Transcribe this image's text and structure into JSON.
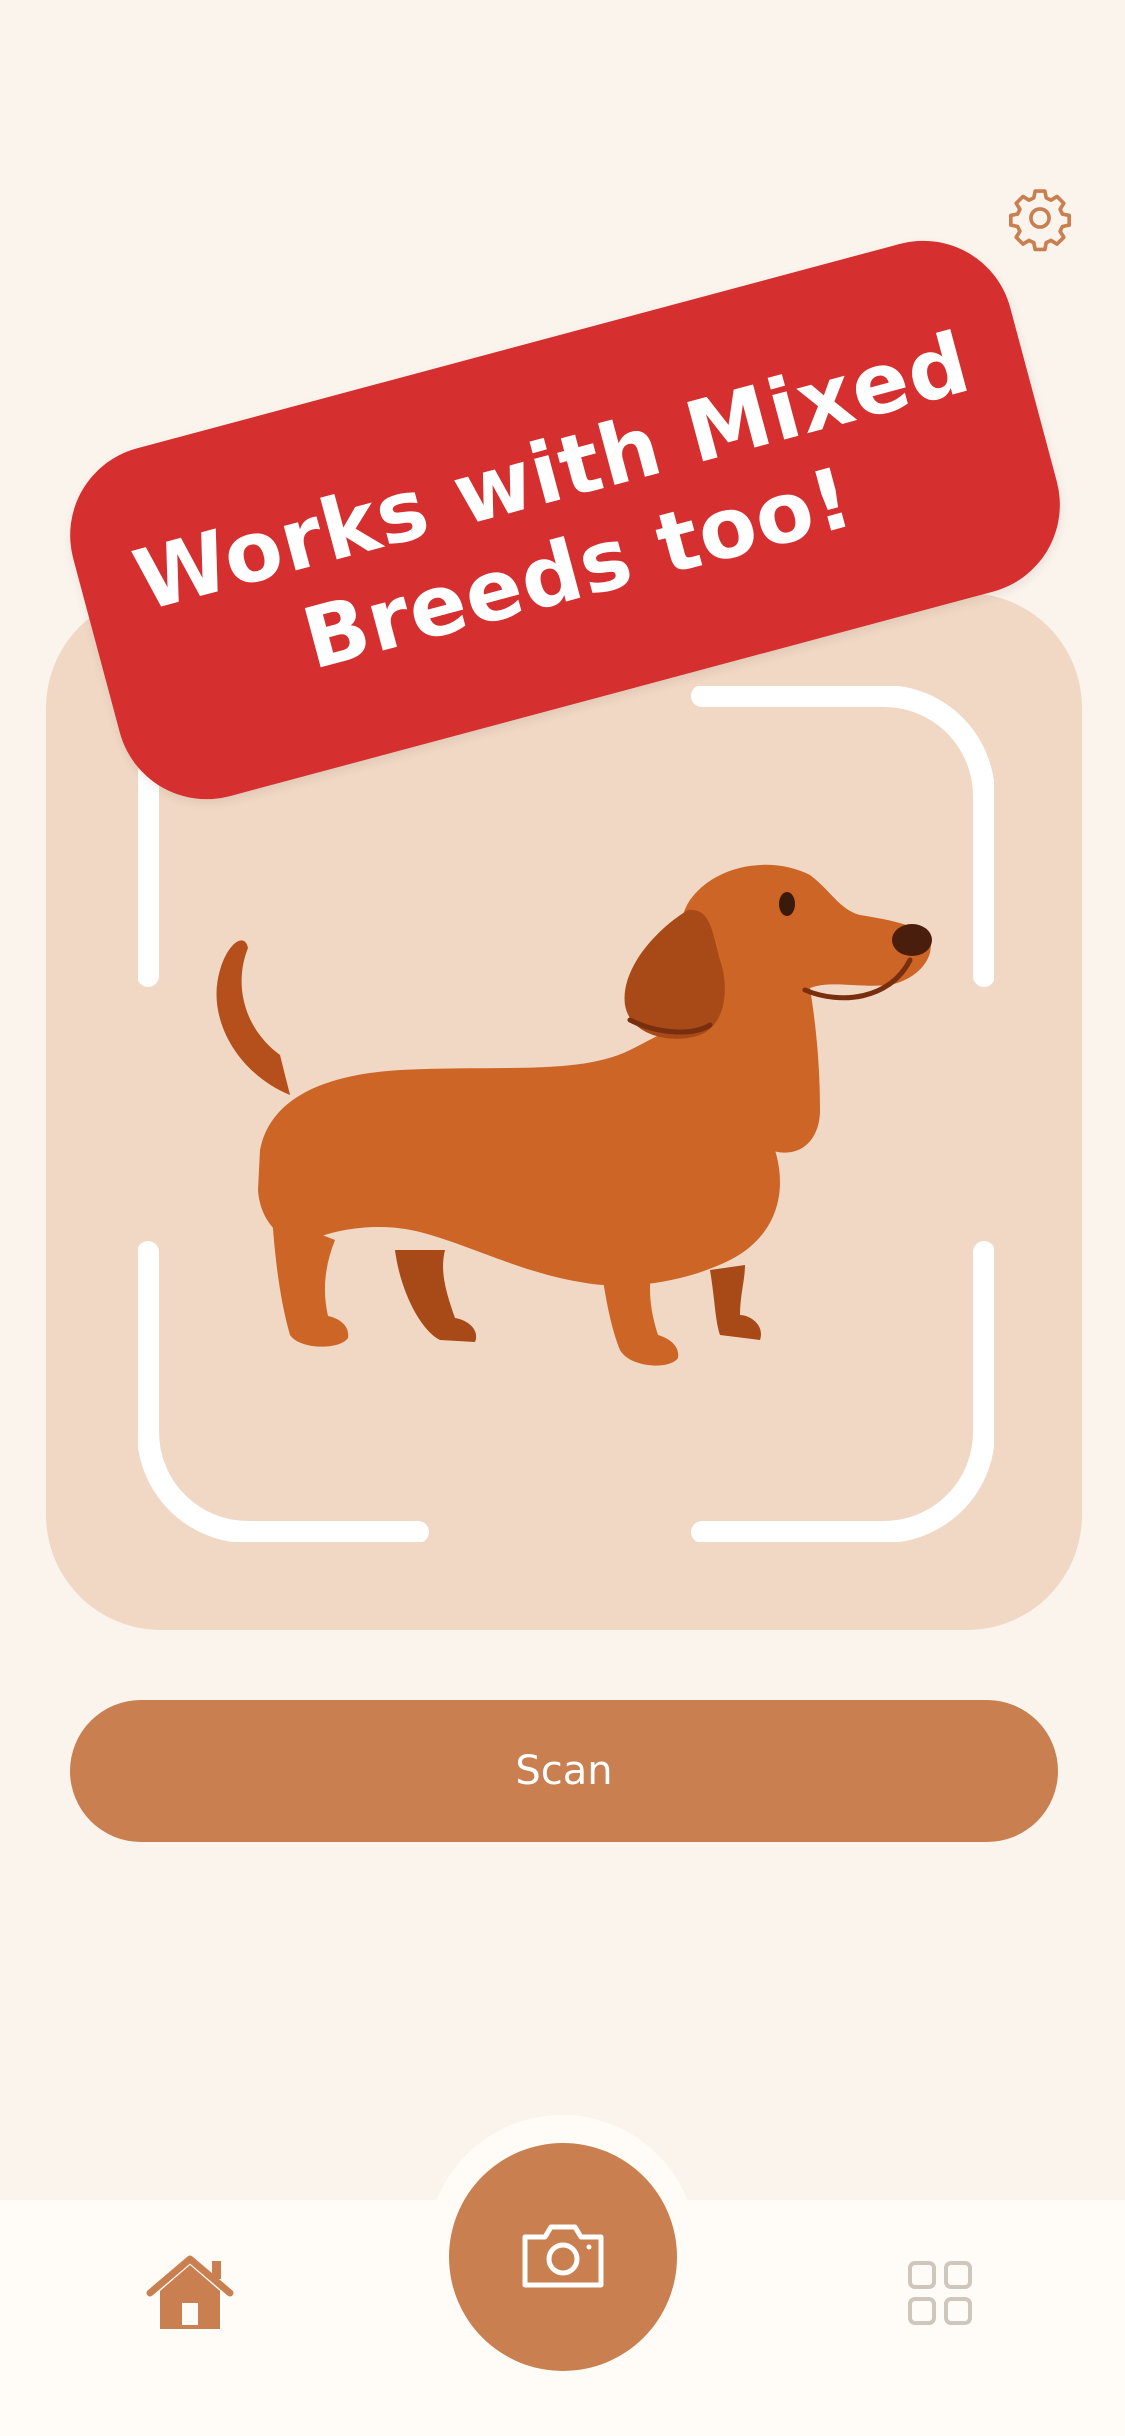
{
  "banner": {
    "text": "Works with Mixed Breeds too!"
  },
  "scan": {
    "button_label": "Scan"
  },
  "icons": {
    "settings": "gear-icon",
    "home": "home-icon",
    "camera": "camera-icon",
    "grid": "grid-icon"
  },
  "colors": {
    "background": "#fbf4ec",
    "card": "#f1d8c4",
    "accent": "#c97f50",
    "banner": "#d52f2f",
    "tabbar": "#fffcf7"
  }
}
